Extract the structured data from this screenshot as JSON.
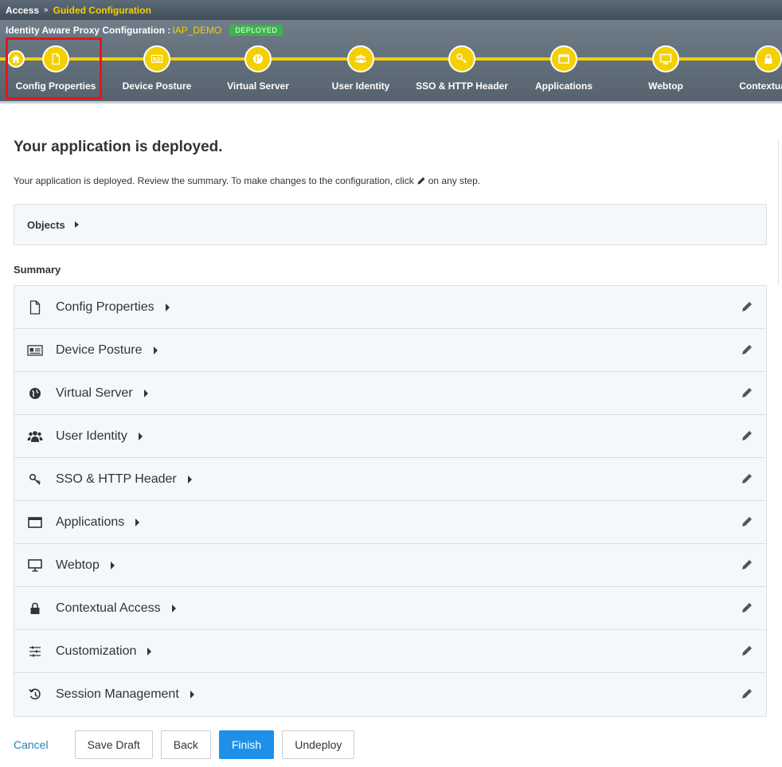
{
  "breadcrumb": {
    "root": "Access",
    "separator": "»",
    "current": "Guided Configuration"
  },
  "wizard": {
    "title": "Identity Aware Proxy Configuration :",
    "app_name": "IAP_DEMO",
    "status_badge": "DEPLOYED",
    "steps": [
      {
        "label": "Config Properties",
        "icon": "document-icon"
      },
      {
        "label": "Device Posture",
        "icon": "id-card-icon"
      },
      {
        "label": "Virtual Server",
        "icon": "globe-icon"
      },
      {
        "label": "User Identity",
        "icon": "users-icon"
      },
      {
        "label": "SSO & HTTP Header",
        "icon": "key-icon"
      },
      {
        "label": "Applications",
        "icon": "window-icon"
      },
      {
        "label": "Webtop",
        "icon": "monitor-icon"
      },
      {
        "label": "Contextual A",
        "icon": "lock-icon"
      }
    ],
    "accent_color": "#f5d000"
  },
  "main": {
    "heading": "Your application is deployed.",
    "description_before": "Your application is deployed. Review the summary. To make changes to the configuration, click",
    "description_after": "on any step.",
    "objects_label": "Objects",
    "summary_label": "Summary",
    "summary_items": [
      {
        "label": "Config Properties",
        "icon": "document-icon"
      },
      {
        "label": "Device Posture",
        "icon": "id-card-icon"
      },
      {
        "label": "Virtual Server",
        "icon": "globe-icon"
      },
      {
        "label": "User Identity",
        "icon": "users-icon"
      },
      {
        "label": "SSO & HTTP Header",
        "icon": "key-icon"
      },
      {
        "label": "Applications",
        "icon": "window-icon"
      },
      {
        "label": "Webtop",
        "icon": "monitor-icon"
      },
      {
        "label": "Contextual Access",
        "icon": "lock-icon"
      },
      {
        "label": "Customization",
        "icon": "sliders-icon"
      },
      {
        "label": "Session Management",
        "icon": "history-icon"
      }
    ]
  },
  "footer": {
    "cancel": "Cancel",
    "save_draft": "Save Draft",
    "back": "Back",
    "finish": "Finish",
    "undeploy": "Undeploy"
  }
}
